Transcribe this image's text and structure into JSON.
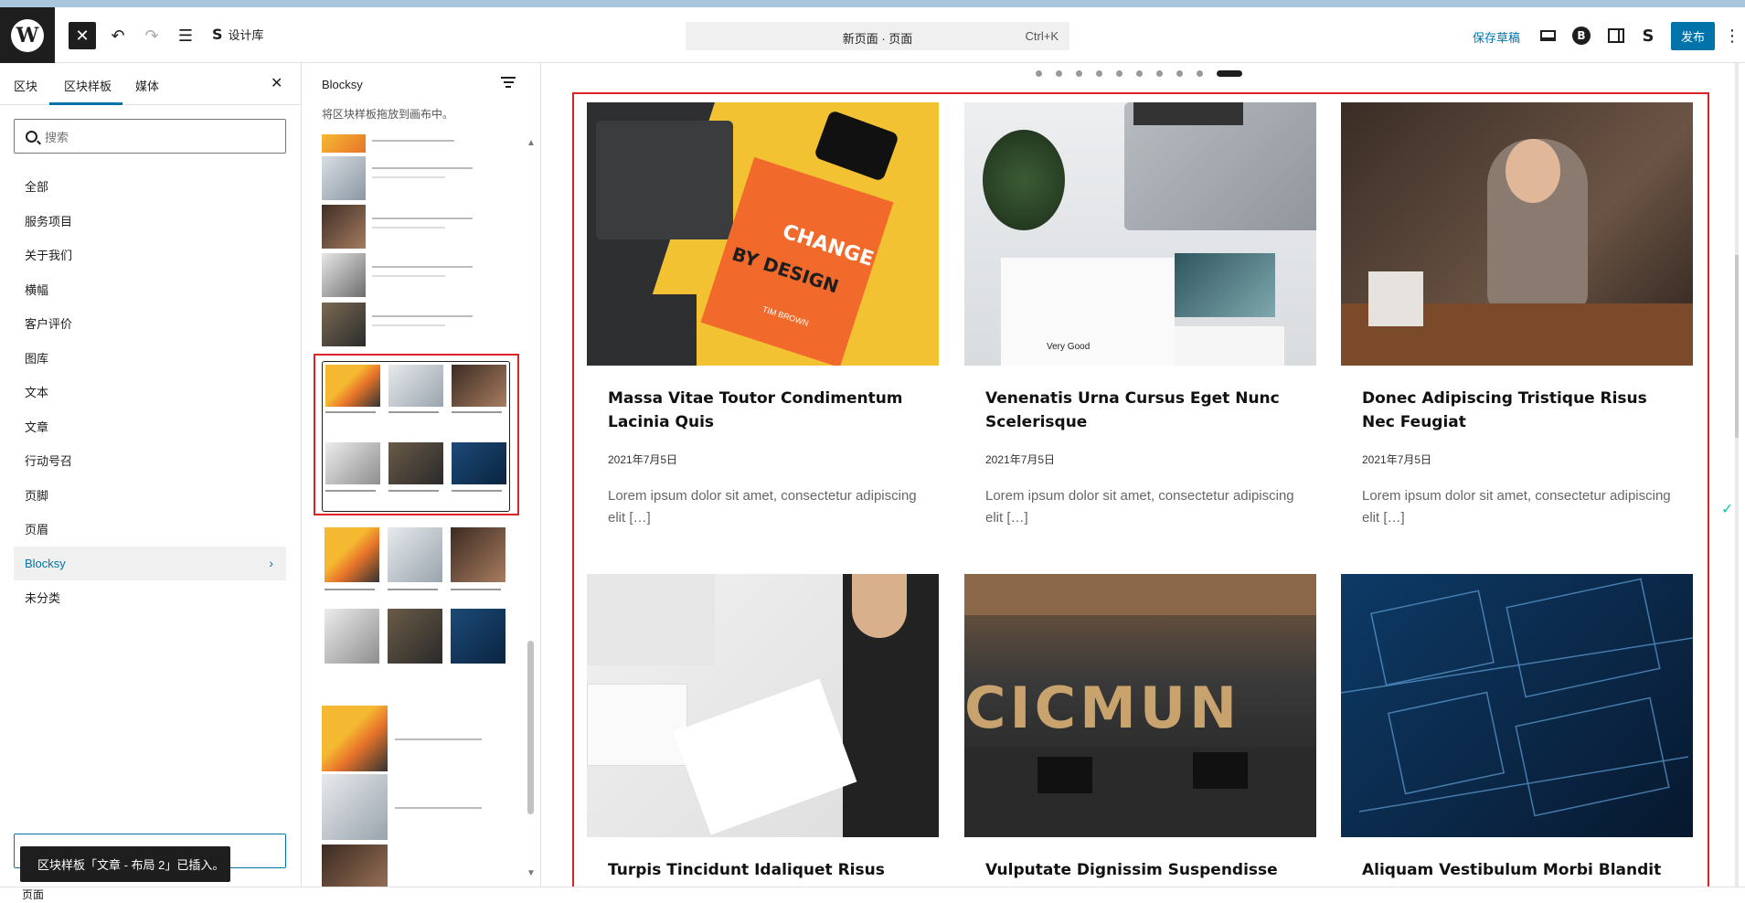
{
  "header": {
    "logo_letter": "W",
    "design_library_label": "设计库",
    "command_bar_title": "新页面 · 页面",
    "command_bar_shortcut": "Ctrl+K",
    "save_draft_label": "保存草稿",
    "blocksy_badge": "B",
    "publish_label": "发布"
  },
  "sidebar": {
    "tabs": [
      "区块",
      "区块样板",
      "媒体"
    ],
    "active_tab": "区块样板",
    "search_placeholder": "搜索",
    "categories": [
      {
        "label": "全部"
      },
      {
        "label": "服务项目"
      },
      {
        "label": "关于我们"
      },
      {
        "label": "横幅"
      },
      {
        "label": "客户评价"
      },
      {
        "label": "图库"
      },
      {
        "label": "文本"
      },
      {
        "label": "文章"
      },
      {
        "label": "行动号召"
      },
      {
        "label": "页脚"
      },
      {
        "label": "页眉"
      },
      {
        "label": "Blocksy",
        "active": true
      },
      {
        "label": "未分类"
      }
    ]
  },
  "pattern_panel": {
    "title": "Blocksy",
    "description": "将区块样板拖放到画布中。"
  },
  "toast": {
    "message": "区块样板「文章 - 布局 2」已插入。"
  },
  "canvas": {
    "carousel_dots": 10,
    "carousel_active_index": 9,
    "posts": [
      {
        "title": "Massa Vitae Toutor Condimentum Lacinia Quis",
        "date": "2021年7月5日",
        "excerpt": "Lorem ipsum dolor sit amet, consectetur adipiscing elit […]",
        "image": "book-change-by-design"
      },
      {
        "title": "Venenatis Urna Cursus Eget Nunc Scelerisque",
        "date": "2021年7月5日",
        "excerpt": "Lorem ipsum dolor sit amet, consectetur adipiscing elit […]",
        "image": "laptop-plant-desk"
      },
      {
        "title": "Donec Adipiscing Tristique Risus Nec Feugiat",
        "date": "2021年7月5日",
        "excerpt": "Lorem ipsum dolor sit amet, consectetur adipiscing elit […]",
        "image": "woman-with-tablet"
      },
      {
        "title": "Turpis Tincidunt Idaliquet Risus Feugiat",
        "image": "man-writing-calligraphy"
      },
      {
        "title": "Vulputate Dignissim Suspendisse Inest",
        "image": "office-cicmun-wall"
      },
      {
        "title": "Aliquam Vestibulum Morbi Blandit",
        "image": "blueprint-sketch"
      }
    ]
  },
  "image_text": {
    "book_change": "CHANGE",
    "book_by_design": "BY DESIGN",
    "book_author": "TIM BROWN",
    "card_very_good": "Very Good",
    "wall_letters": "CICMUN"
  },
  "status_bar": {
    "breadcrumb": "页面"
  },
  "colors": {
    "accent": "#0073aa",
    "highlight_frame": "#d9252a",
    "dark": "#1e1e1e"
  }
}
